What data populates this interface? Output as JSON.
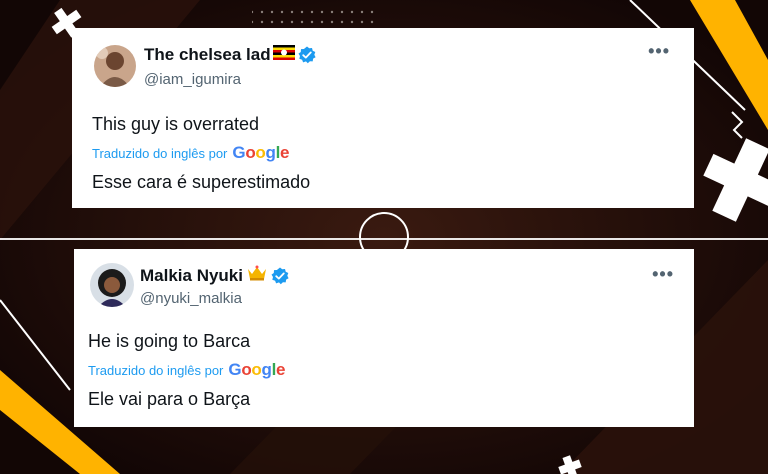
{
  "tweets": [
    {
      "author_name": "The chelsea lad",
      "name_emoji": "uganda-flag",
      "handle": "@iam_igumira",
      "original_text": "This guy is overrated",
      "translated_label": "Traduzido do inglês por",
      "translator_brand": [
        "G",
        "o",
        "o",
        "g",
        "l",
        "e"
      ],
      "translated_text": "Esse cara é superestimado",
      "more_icon": "more-horizontal-icon"
    },
    {
      "author_name": "Malkia Nyuki",
      "name_emoji": "crown",
      "handle": "@nyuki_malkia",
      "original_text": "He is going to Barca",
      "translated_label": "Traduzido do inglês por",
      "translator_brand": [
        "G",
        "o",
        "o",
        "g",
        "l",
        "e"
      ],
      "translated_text": "Ele vai para o Barça",
      "more_icon": "more-horizontal-icon"
    }
  ],
  "colors": {
    "background": "#1a0c08",
    "accent": "#ffb300",
    "link": "#1d9bf0",
    "verified": "#1d9bf0"
  }
}
